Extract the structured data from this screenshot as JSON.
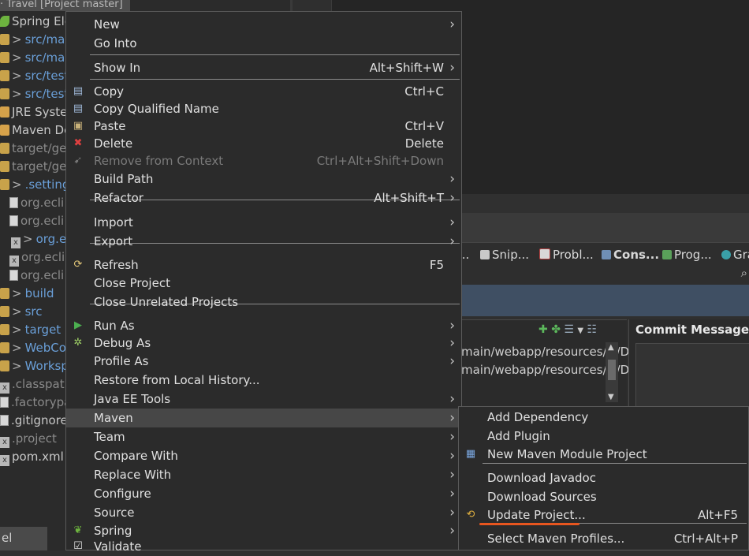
{
  "explorer": {
    "title": "· Travel [Project master]",
    "items": [
      {
        "label": "Spring Ele",
        "style": "white",
        "icon": "spring-icon"
      },
      {
        "label": "src/main",
        "style": "blue",
        "icon": "package-folder-icon",
        "caret": true
      },
      {
        "label": "src/main",
        "style": "blue",
        "icon": "package-folder-icon",
        "caret": true
      },
      {
        "label": "src/test/",
        "style": "blue",
        "icon": "package-folder-icon",
        "caret": true
      },
      {
        "label": "src/test/",
        "style": "blue",
        "icon": "package-folder-icon",
        "caret": true
      },
      {
        "label": "JRE System",
        "style": "white",
        "icon": "library-icon"
      },
      {
        "label": "Maven De",
        "style": "white",
        "icon": "library-icon"
      },
      {
        "label": "target/gen",
        "style": "grey",
        "icon": "folder-icon"
      },
      {
        "label": "target/gen",
        "style": "grey",
        "icon": "folder-icon"
      },
      {
        "label": ".settings",
        "style": "blue",
        "icon": "folder-icon",
        "caret": true
      },
      {
        "label": "org.ecli",
        "style": "grey",
        "icon": "file-icon"
      },
      {
        "label": "org.ecli",
        "style": "grey",
        "icon": "file-icon"
      },
      {
        "label": "org.e",
        "style": "blue",
        "icon": "xml-file-icon",
        "caret": true
      },
      {
        "label": "org.ecli",
        "style": "grey",
        "icon": "xml-file-icon"
      },
      {
        "label": "org.ecli",
        "style": "grey",
        "icon": "file-icon"
      },
      {
        "label": "build",
        "style": "blue",
        "icon": "folder-icon",
        "caret": true
      },
      {
        "label": "src",
        "style": "blue",
        "icon": "folder-icon",
        "caret": true
      },
      {
        "label": "target",
        "style": "blue",
        "icon": "folder-icon",
        "caret": true
      },
      {
        "label": "WebCor",
        "style": "blue",
        "icon": "folder-icon",
        "caret": true
      },
      {
        "label": "Workspa",
        "style": "blue",
        "icon": "folder-icon",
        "caret": true
      },
      {
        "label": ".classpath",
        "style": "grey",
        "icon": "xml-file-icon"
      },
      {
        "label": ".factorypat",
        "style": "grey",
        "icon": "file-icon"
      },
      {
        "label": ".gitignore",
        "style": "white",
        "icon": "file-icon"
      },
      {
        "label": ".project",
        "style": "grey",
        "icon": "xml-file-icon"
      },
      {
        "label": "pom.xml",
        "style": "white",
        "icon": "xml-file-icon"
      }
    ],
    "bottom_tab": "el"
  },
  "views": {
    "tabs": [
      "...",
      "Snip...",
      "Probl...",
      "Cons...",
      "Prog...",
      "Gra"
    ],
    "staged_lines": [
      "main/webapp/resources/js/D",
      "main/webapp/resources/js/D"
    ],
    "commit_title": "Commit Message"
  },
  "context_menu": {
    "items": [
      {
        "label": "New",
        "shortcut": "",
        "submenu": true,
        "icon": ""
      },
      {
        "label": "Go Into",
        "shortcut": "",
        "submenu": false,
        "icon": ""
      },
      {
        "label": "Show In",
        "shortcut": "Alt+Shift+W",
        "submenu": true,
        "icon": ""
      },
      {
        "label": "Copy",
        "shortcut": "Ctrl+C",
        "submenu": false,
        "icon": "copy-icon"
      },
      {
        "label": "Copy Qualified Name",
        "shortcut": "",
        "submenu": false,
        "icon": "copy-qualified-name-icon"
      },
      {
        "label": "Paste",
        "shortcut": "Ctrl+V",
        "submenu": false,
        "icon": "paste-icon"
      },
      {
        "label": "Delete",
        "shortcut": "Delete",
        "submenu": false,
        "icon": "delete-icon"
      },
      {
        "label": "Remove from Context",
        "shortcut": "Ctrl+Alt+Shift+Down",
        "submenu": false,
        "icon": "remove-context-icon",
        "disabled": true
      },
      {
        "label": "Build Path",
        "shortcut": "",
        "submenu": true,
        "icon": ""
      },
      {
        "label": "Refactor",
        "shortcut": "Alt+Shift+T",
        "submenu": true,
        "icon": ""
      },
      {
        "label": "Import",
        "shortcut": "",
        "submenu": true,
        "icon": ""
      },
      {
        "label": "Export",
        "shortcut": "",
        "submenu": true,
        "icon": ""
      },
      {
        "label": "Refresh",
        "shortcut": "F5",
        "submenu": false,
        "icon": "refresh-icon"
      },
      {
        "label": "Close Project",
        "shortcut": "",
        "submenu": false,
        "icon": ""
      },
      {
        "label": "Close Unrelated Projects",
        "shortcut": "",
        "submenu": false,
        "icon": ""
      },
      {
        "label": "Run As",
        "shortcut": "",
        "submenu": true,
        "icon": "run-icon"
      },
      {
        "label": "Debug As",
        "shortcut": "",
        "submenu": true,
        "icon": "debug-icon"
      },
      {
        "label": "Profile As",
        "shortcut": "",
        "submenu": true,
        "icon": ""
      },
      {
        "label": "Restore from Local History...",
        "shortcut": "",
        "submenu": false,
        "icon": ""
      },
      {
        "label": "Java EE Tools",
        "shortcut": "",
        "submenu": true,
        "icon": ""
      },
      {
        "label": "Maven",
        "shortcut": "",
        "submenu": true,
        "icon": "",
        "active": true
      },
      {
        "label": "Team",
        "shortcut": "",
        "submenu": true,
        "icon": ""
      },
      {
        "label": "Compare With",
        "shortcut": "",
        "submenu": true,
        "icon": ""
      },
      {
        "label": "Replace With",
        "shortcut": "",
        "submenu": true,
        "icon": ""
      },
      {
        "label": "Configure",
        "shortcut": "",
        "submenu": true,
        "icon": ""
      },
      {
        "label": "Source",
        "shortcut": "",
        "submenu": true,
        "icon": ""
      },
      {
        "label": "Spring",
        "shortcut": "",
        "submenu": true,
        "icon": "spring-icon"
      },
      {
        "label": "Validate",
        "shortcut": "",
        "submenu": false,
        "icon": "validate-icon"
      }
    ]
  },
  "maven_submenu": {
    "items": [
      {
        "label": "Add Dependency",
        "shortcut": "",
        "icon": ""
      },
      {
        "label": "Add Plugin",
        "shortcut": "",
        "icon": ""
      },
      {
        "label": "New Maven Module Project",
        "shortcut": "",
        "icon": "maven-module-icon"
      },
      {
        "label": "Download Javadoc",
        "shortcut": "",
        "icon": ""
      },
      {
        "label": "Download Sources",
        "shortcut": "",
        "icon": ""
      },
      {
        "label": "Update Project...",
        "shortcut": "Alt+F5",
        "icon": "update-project-icon",
        "highlighted": true
      },
      {
        "label": "Select Maven Profiles...",
        "shortcut": "Ctrl+Alt+P",
        "icon": ""
      }
    ]
  },
  "colors": {
    "menu_bg": "#2b2b2b",
    "active_item": "#474747",
    "highlight_underline": "#e8561f"
  }
}
